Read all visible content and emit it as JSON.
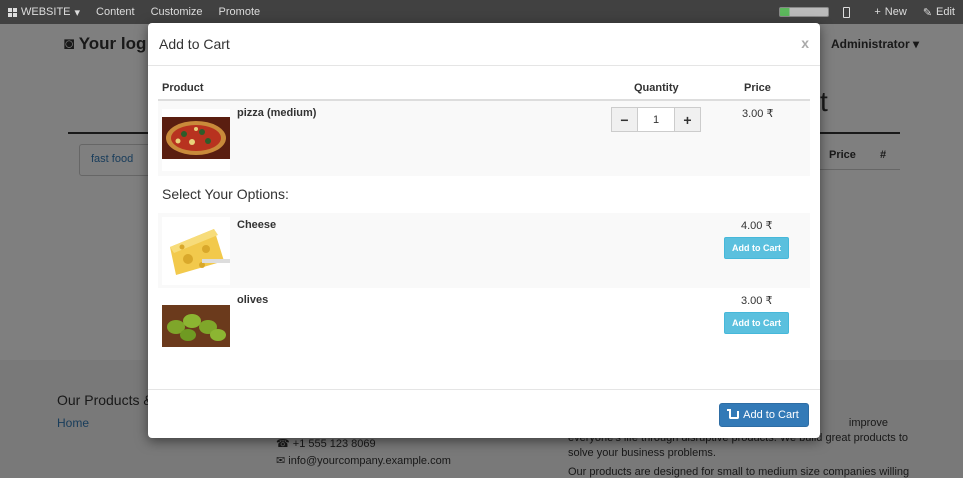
{
  "topbar": {
    "website": "WEBSITE",
    "content": "Content",
    "customize": "Customize",
    "promote": "Promote",
    "new": "New",
    "edit": "Edit"
  },
  "background": {
    "logo": "Your log",
    "admin": "Administrator",
    "big_letter": "t",
    "tag": "fast food",
    "price_header": "Price",
    "hash_header": "#",
    "footer_title": "Our Products &",
    "footer_home": "Home",
    "phone": "+1 555 123 8069",
    "email": "info@yourcompany.example.com",
    "about_text": "everyone's life through disruptive products. We build great products to solve your business problems.",
    "about_improve": "improve",
    "about_text2": "Our products are designed for small to medium size companies willing"
  },
  "modal": {
    "title": "Add to Cart",
    "close": "x",
    "headers": {
      "product": "Product",
      "quantity": "Quantity",
      "price": "Price"
    },
    "main_product": {
      "name": "pizza (medium)",
      "quantity": "1",
      "price": "3.00 ₹"
    },
    "options_title": "Select Your Options:",
    "options": [
      {
        "name": "Cheese",
        "price": "4.00 ₹",
        "button": "Add to Cart"
      },
      {
        "name": "olives",
        "price": "3.00 ₹",
        "button": "Add to Cart"
      }
    ],
    "footer_button": "Add to Cart"
  },
  "colors": {
    "primary": "#337ab7",
    "info": "#5bc0de",
    "topbar": "#414141"
  }
}
